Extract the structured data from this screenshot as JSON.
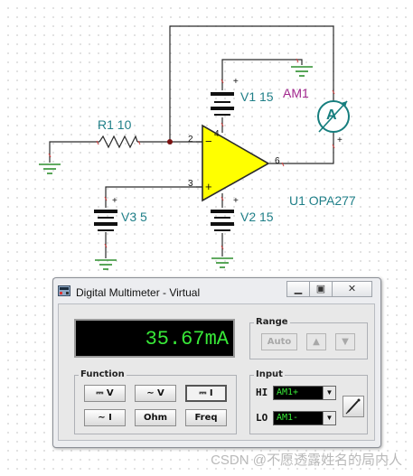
{
  "schematic": {
    "r1_label": "R1 10",
    "v1_label": "V1 15",
    "v2_label": "V2 15",
    "v3_label": "V3 5",
    "am1_label": "AM1",
    "u1_label": "U1 OPA277",
    "ammeter_symbol": "A",
    "pin2": "2",
    "pin3": "3",
    "pin4": "4",
    "pin6": "6",
    "op_minus": "−",
    "op_plus": "+",
    "plus": "+",
    "colors": {
      "wire": "#2b2b2b",
      "label": "#1f7f88",
      "ammeter_label": "#a0258c",
      "opamp_fill": "#ffff00",
      "ammeter": "#167e7e"
    }
  },
  "multimeter": {
    "title": "Digital Multimeter - Virtual",
    "window_buttons": {
      "minimize": "▁",
      "maximize": "▣",
      "close": "✕"
    },
    "reading": "35.67mA",
    "range": {
      "title": "Range",
      "auto": "Auto",
      "up_icon": "▲",
      "down_icon": "▼"
    },
    "function": {
      "title": "Function",
      "dc_voltage": "⎓ V",
      "ac_voltage": "∼ V",
      "dc_current": "⎓ I",
      "ac_current": "∼ I",
      "ohm": "Ohm",
      "freq": "Freq"
    },
    "input": {
      "title": "Input",
      "hi_label": "HI",
      "lo_label": "LO",
      "hi_value": "AM1+",
      "lo_value": "AM1-",
      "dropdown_icon": "▼"
    }
  },
  "watermark": "CSDN @不愿透露姓名的局内人"
}
